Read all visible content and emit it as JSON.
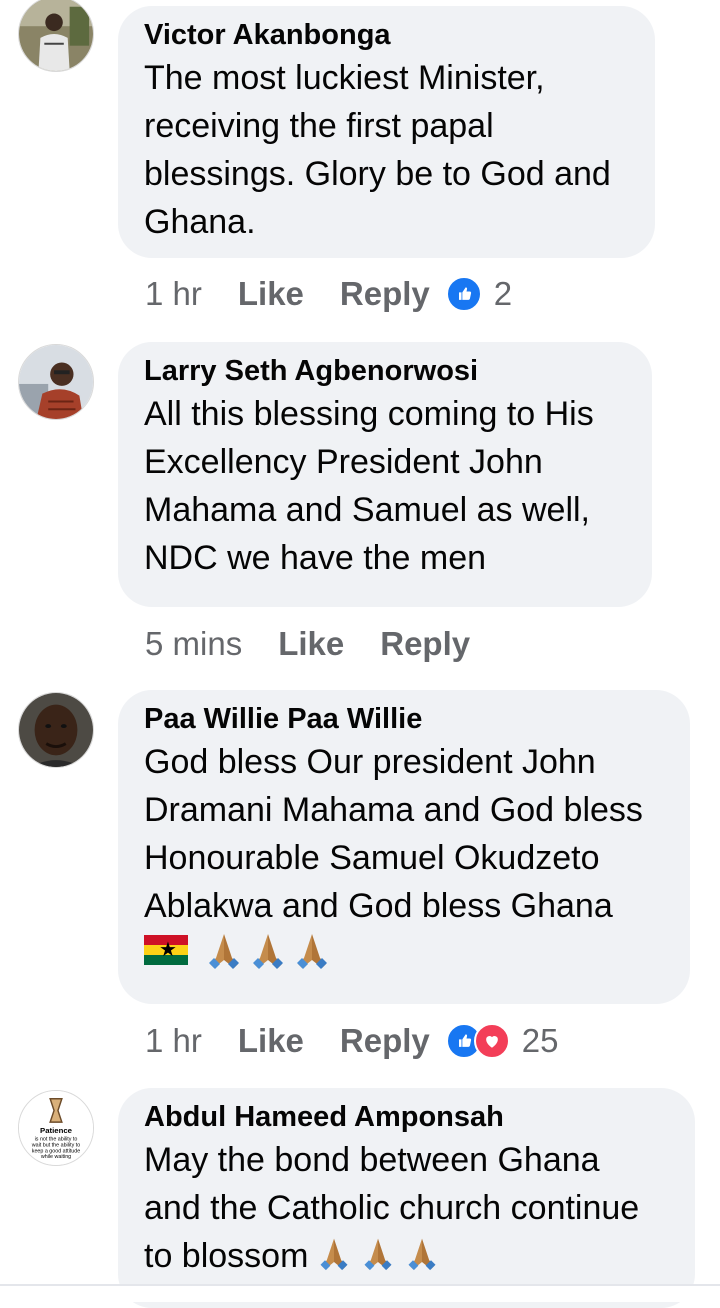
{
  "comments": [
    {
      "author": "Victor Akanbonga",
      "lines": [
        "The most luckiest Minister,",
        "receiving the first papal",
        "blessings. Glory be to God and",
        "Ghana."
      ],
      "time": "1 hr",
      "like_label": "Like",
      "reply_label": "Reply",
      "reaction_count": "2",
      "reactions": [
        "like-icon"
      ]
    },
    {
      "author": "Larry Seth Agbenorwosi",
      "lines": [
        "All this blessing coming to His",
        "Excellency President John",
        "Mahama and Samuel as well,",
        "NDC we have the men"
      ],
      "time": "5 mins",
      "like_label": "Like",
      "reply_label": "Reply"
    },
    {
      "author": "Paa Willie Paa Willie",
      "lines": [
        "God bless Our president John",
        "Dramani Mahama and God bless",
        "Honourable Samuel Okudzeto",
        "Ablakwa and God bless Ghana"
      ],
      "emojis": [
        "ghana-flag-icon",
        "praying-hands-icon",
        "praying-hands-icon",
        "praying-hands-icon"
      ],
      "time": "1 hr",
      "like_label": "Like",
      "reply_label": "Reply",
      "reaction_count": "25",
      "reactions": [
        "like-icon",
        "love-icon"
      ]
    },
    {
      "author": "Abdul Hameed Amponsah",
      "lines": [
        "May the bond between Ghana",
        "and the Catholic church continue",
        "to blossom"
      ],
      "trailing_emojis": [
        "praying-hands-icon",
        "praying-hands-icon",
        "praying-hands-icon"
      ],
      "avatar_text": {
        "title": "Patience",
        "line1": "is not the ability to",
        "line2": "wait but the ability to",
        "line3": "keep a good attitude",
        "line4": "while waiting"
      }
    }
  ],
  "colors": {
    "bubble": "#f0f2f5",
    "meta_text": "#65676b",
    "like_blue": "#1877f2",
    "love_red": "#f33e58"
  }
}
